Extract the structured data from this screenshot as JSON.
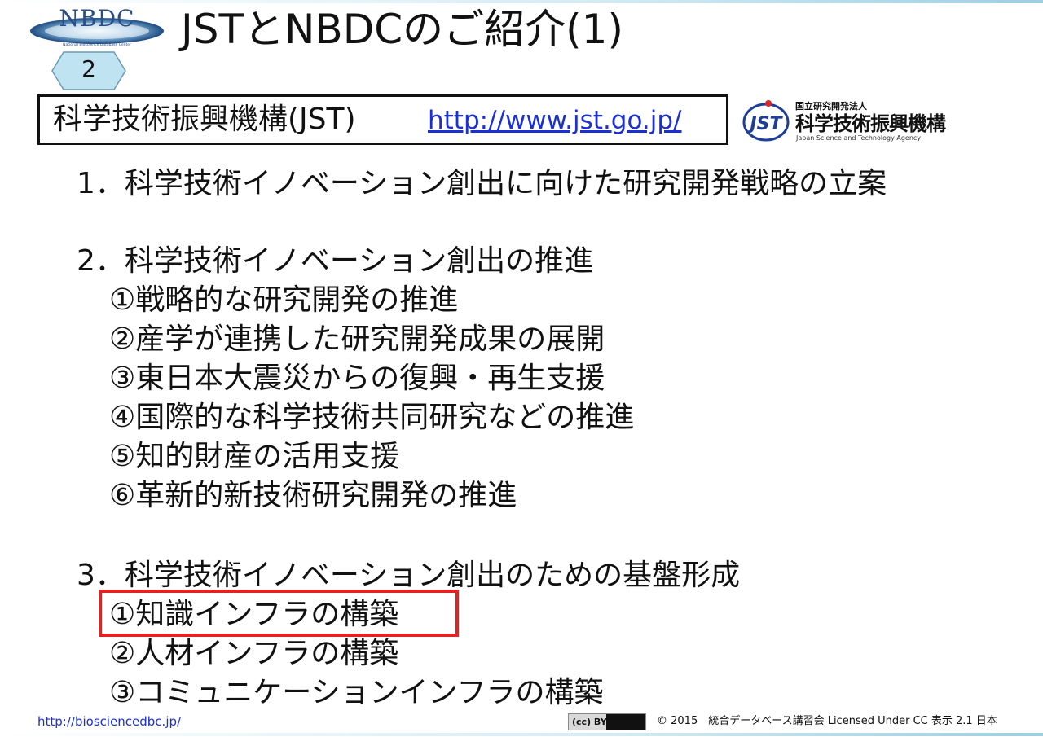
{
  "header": {
    "logo_text": "NBDC",
    "logo_subtext": "National Bioscience Database Center",
    "title": "JSTとNBDCのご紹介(1)",
    "page_number": "2"
  },
  "org": {
    "name": "科学技術振興機構(JST)",
    "url": "http://www.jst.go.jp/",
    "logo_mark": "JST",
    "logo_small": "国立研究開発法人",
    "logo_name": "科学技術振興機構",
    "logo_english": "Japan Science and Technology Agency"
  },
  "content": {
    "s1": "1．科学技術イノベーション創出に向けた研究開発戦略の立案",
    "s2": "2．科学技術イノベーション創出の推進",
    "s2_items": [
      "①戦略的な研究開発の推進",
      "②産学が連携した研究開発成果の展開",
      "③東日本大震災からの復興・再生支援",
      "④国際的な科学技術共同研究などの推進",
      "⑤知的財産の活用支援",
      "⑥革新的新技術研究開発の推進"
    ],
    "s3": "3．科学技術イノベーション創出のための基盤形成",
    "s3_items": [
      "①知識インフラの構築",
      "②人材インフラの構築",
      "③コミュニケーションインフラの構築"
    ]
  },
  "footer": {
    "url": "http://biosciencedbc.jp/",
    "cc_badge": "(cc) BY",
    "copyright": "© 2015　統合データベース講習会 Licensed Under CC 表示 2.1 日本"
  },
  "colors": {
    "accent_red": "#e02424",
    "link_blue": "#1a2fd6",
    "nbdc_blue": "#2a4f86",
    "jst_blue": "#1f3f96",
    "hex_fill": "#bfe3f0"
  },
  "icons": [
    "nbdc-logo-icon",
    "hexagon-badge-icon",
    "jst-logo-icon",
    "cc-by-icon"
  ]
}
